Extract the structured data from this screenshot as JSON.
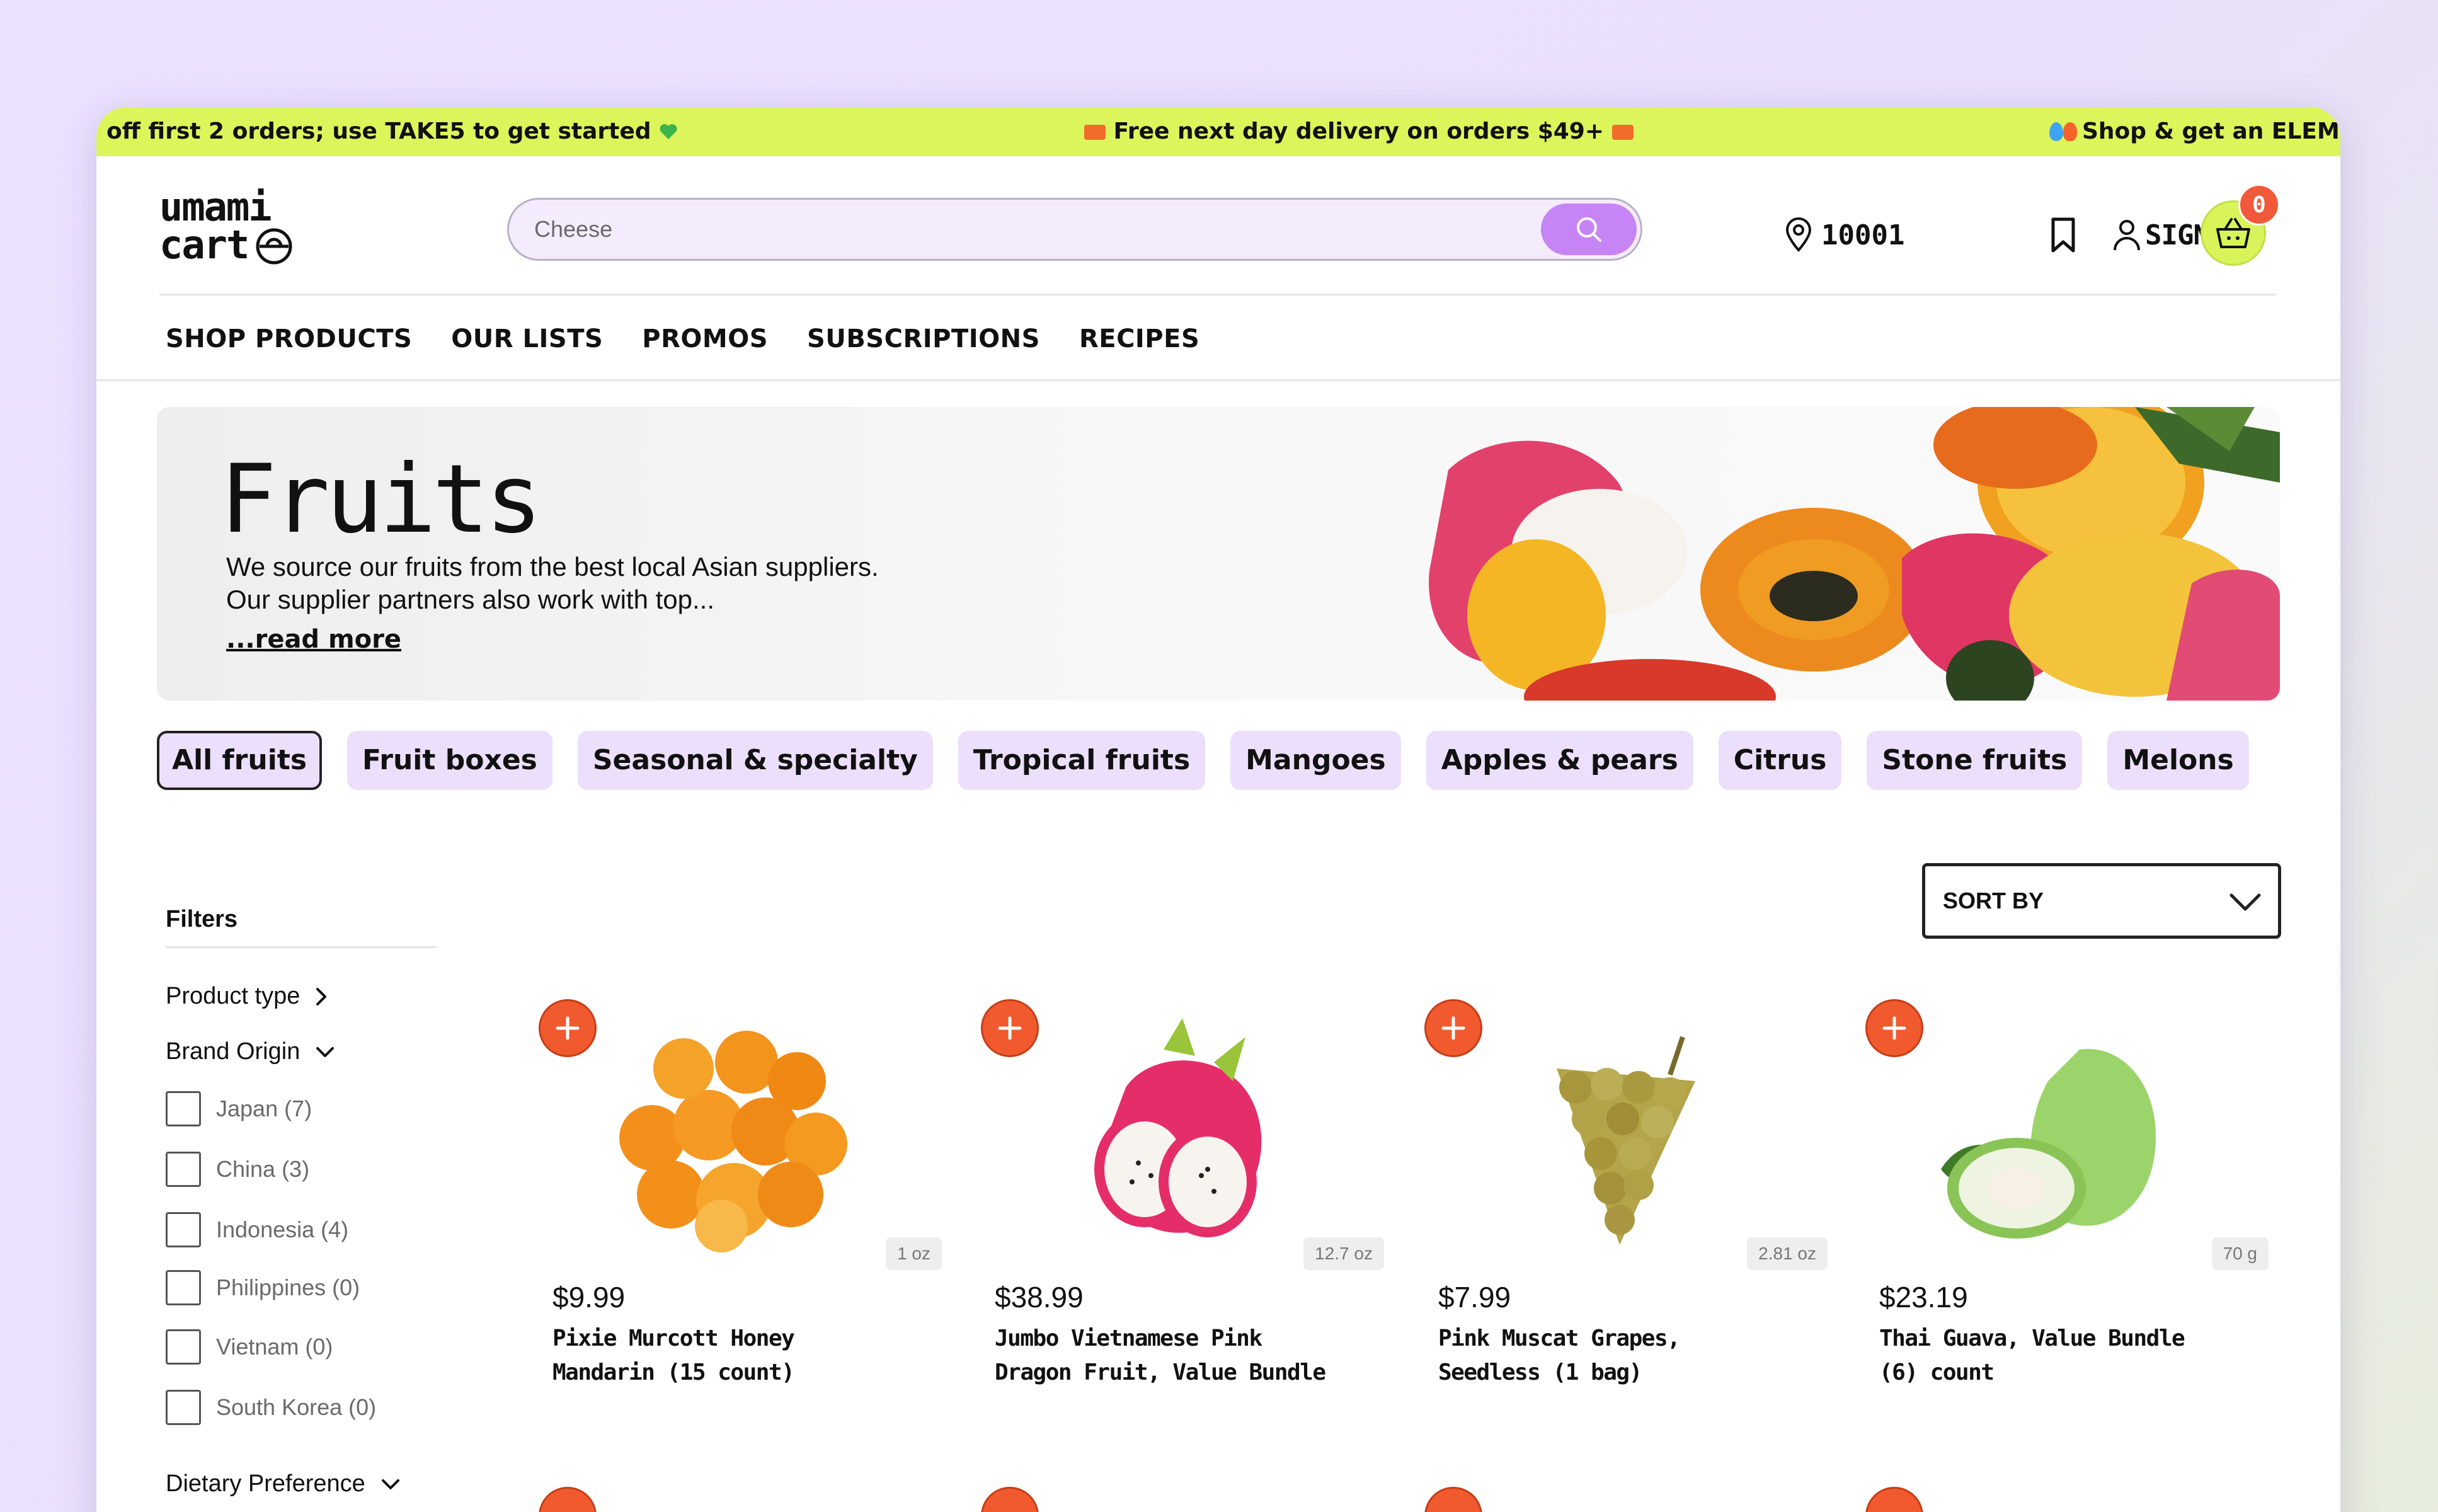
{
  "promo": {
    "left": "off first 2 orders; use TAKE5 to get started",
    "center": "Free next day delivery on orders $49+",
    "right": "Shop & get an ELEM..."
  },
  "logo": {
    "line1": "umami",
    "line2": "cart"
  },
  "search": {
    "value": "Cheese",
    "placeholder": "Cheese"
  },
  "header": {
    "zip": "10001",
    "sign_in": "SIGN IN",
    "cart_count": "0"
  },
  "nav": [
    "SHOP PRODUCTS",
    "OUR LISTS",
    "PROMOS",
    "SUBSCRIPTIONS",
    "RECIPES"
  ],
  "hero": {
    "title": "Fruits",
    "desc_line1": "We source our fruits from the best local Asian suppliers.",
    "desc_line2": "Our supplier partners also work with top...",
    "read_more": "...read more"
  },
  "categories": [
    "All fruits",
    "Fruit boxes",
    "Seasonal & specialty",
    "Tropical fruits",
    "Mangoes",
    "Apples & pears",
    "Citrus",
    "Stone fruits",
    "Melons"
  ],
  "sort": {
    "label": "SORT BY"
  },
  "filters": {
    "title": "Filters",
    "product_type": "Product type",
    "brand_origin": "Brand Origin",
    "origins": [
      "Japan (7)",
      "China (3)",
      "Indonesia (4)",
      "Philippines (0)",
      "Vietnam (0)",
      "South Korea (0)"
    ],
    "dietary": "Dietary Preference"
  },
  "products": [
    {
      "price": "$9.99",
      "name_line1": "Pixie Murcott Honey",
      "name_line2": "Mandarin (15 count)",
      "weight": "1 oz"
    },
    {
      "price": "$38.99",
      "name_line1": "Jumbo Vietnamese Pink",
      "name_line2": "Dragon Fruit, Value Bundle",
      "weight": "12.7 oz"
    },
    {
      "price": "$7.99",
      "name_line1": "Pink Muscat Grapes,",
      "name_line2": "Seedless (1 bag)",
      "weight": "2.81 oz"
    },
    {
      "price": "$23.19",
      "name_line1": "Thai Guava, Value Bundle",
      "name_line2": "(6) count",
      "weight": "70 g"
    }
  ],
  "colors": {
    "promo_bg": "#dcf55b",
    "chip_bg": "#ecdffb",
    "add_button": "#f05a2e",
    "search_button": "#c784f5"
  }
}
